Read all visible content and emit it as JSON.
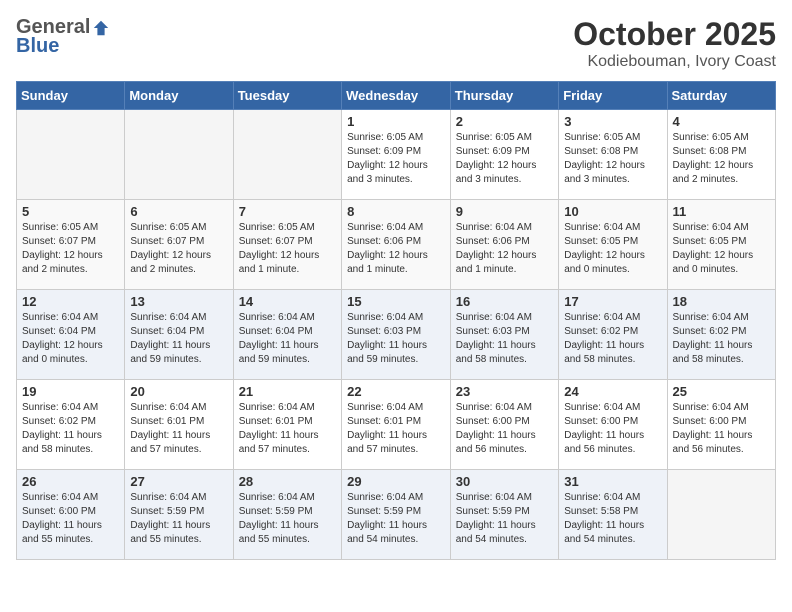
{
  "header": {
    "logo": {
      "general": "General",
      "blue": "Blue"
    },
    "title": "October 2025",
    "location": "Kodiebouman, Ivory Coast"
  },
  "calendar": {
    "days_of_week": [
      "Sunday",
      "Monday",
      "Tuesday",
      "Wednesday",
      "Thursday",
      "Friday",
      "Saturday"
    ],
    "weeks": [
      [
        {
          "num": "",
          "info": ""
        },
        {
          "num": "",
          "info": ""
        },
        {
          "num": "",
          "info": ""
        },
        {
          "num": "1",
          "info": "Sunrise: 6:05 AM\nSunset: 6:09 PM\nDaylight: 12 hours\nand 3 minutes."
        },
        {
          "num": "2",
          "info": "Sunrise: 6:05 AM\nSunset: 6:09 PM\nDaylight: 12 hours\nand 3 minutes."
        },
        {
          "num": "3",
          "info": "Sunrise: 6:05 AM\nSunset: 6:08 PM\nDaylight: 12 hours\nand 3 minutes."
        },
        {
          "num": "4",
          "info": "Sunrise: 6:05 AM\nSunset: 6:08 PM\nDaylight: 12 hours\nand 2 minutes."
        }
      ],
      [
        {
          "num": "5",
          "info": "Sunrise: 6:05 AM\nSunset: 6:07 PM\nDaylight: 12 hours\nand 2 minutes."
        },
        {
          "num": "6",
          "info": "Sunrise: 6:05 AM\nSunset: 6:07 PM\nDaylight: 12 hours\nand 2 minutes."
        },
        {
          "num": "7",
          "info": "Sunrise: 6:05 AM\nSunset: 6:07 PM\nDaylight: 12 hours\nand 1 minute."
        },
        {
          "num": "8",
          "info": "Sunrise: 6:04 AM\nSunset: 6:06 PM\nDaylight: 12 hours\nand 1 minute."
        },
        {
          "num": "9",
          "info": "Sunrise: 6:04 AM\nSunset: 6:06 PM\nDaylight: 12 hours\nand 1 minute."
        },
        {
          "num": "10",
          "info": "Sunrise: 6:04 AM\nSunset: 6:05 PM\nDaylight: 12 hours\nand 0 minutes."
        },
        {
          "num": "11",
          "info": "Sunrise: 6:04 AM\nSunset: 6:05 PM\nDaylight: 12 hours\nand 0 minutes."
        }
      ],
      [
        {
          "num": "12",
          "info": "Sunrise: 6:04 AM\nSunset: 6:04 PM\nDaylight: 12 hours\nand 0 minutes."
        },
        {
          "num": "13",
          "info": "Sunrise: 6:04 AM\nSunset: 6:04 PM\nDaylight: 11 hours\nand 59 minutes."
        },
        {
          "num": "14",
          "info": "Sunrise: 6:04 AM\nSunset: 6:04 PM\nDaylight: 11 hours\nand 59 minutes."
        },
        {
          "num": "15",
          "info": "Sunrise: 6:04 AM\nSunset: 6:03 PM\nDaylight: 11 hours\nand 59 minutes."
        },
        {
          "num": "16",
          "info": "Sunrise: 6:04 AM\nSunset: 6:03 PM\nDaylight: 11 hours\nand 58 minutes."
        },
        {
          "num": "17",
          "info": "Sunrise: 6:04 AM\nSunset: 6:02 PM\nDaylight: 11 hours\nand 58 minutes."
        },
        {
          "num": "18",
          "info": "Sunrise: 6:04 AM\nSunset: 6:02 PM\nDaylight: 11 hours\nand 58 minutes."
        }
      ],
      [
        {
          "num": "19",
          "info": "Sunrise: 6:04 AM\nSunset: 6:02 PM\nDaylight: 11 hours\nand 58 minutes."
        },
        {
          "num": "20",
          "info": "Sunrise: 6:04 AM\nSunset: 6:01 PM\nDaylight: 11 hours\nand 57 minutes."
        },
        {
          "num": "21",
          "info": "Sunrise: 6:04 AM\nSunset: 6:01 PM\nDaylight: 11 hours\nand 57 minutes."
        },
        {
          "num": "22",
          "info": "Sunrise: 6:04 AM\nSunset: 6:01 PM\nDaylight: 11 hours\nand 57 minutes."
        },
        {
          "num": "23",
          "info": "Sunrise: 6:04 AM\nSunset: 6:00 PM\nDaylight: 11 hours\nand 56 minutes."
        },
        {
          "num": "24",
          "info": "Sunrise: 6:04 AM\nSunset: 6:00 PM\nDaylight: 11 hours\nand 56 minutes."
        },
        {
          "num": "25",
          "info": "Sunrise: 6:04 AM\nSunset: 6:00 PM\nDaylight: 11 hours\nand 56 minutes."
        }
      ],
      [
        {
          "num": "26",
          "info": "Sunrise: 6:04 AM\nSunset: 6:00 PM\nDaylight: 11 hours\nand 55 minutes."
        },
        {
          "num": "27",
          "info": "Sunrise: 6:04 AM\nSunset: 5:59 PM\nDaylight: 11 hours\nand 55 minutes."
        },
        {
          "num": "28",
          "info": "Sunrise: 6:04 AM\nSunset: 5:59 PM\nDaylight: 11 hours\nand 55 minutes."
        },
        {
          "num": "29",
          "info": "Sunrise: 6:04 AM\nSunset: 5:59 PM\nDaylight: 11 hours\nand 54 minutes."
        },
        {
          "num": "30",
          "info": "Sunrise: 6:04 AM\nSunset: 5:59 PM\nDaylight: 11 hours\nand 54 minutes."
        },
        {
          "num": "31",
          "info": "Sunrise: 6:04 AM\nSunset: 5:58 PM\nDaylight: 11 hours\nand 54 minutes."
        },
        {
          "num": "",
          "info": ""
        }
      ]
    ]
  }
}
